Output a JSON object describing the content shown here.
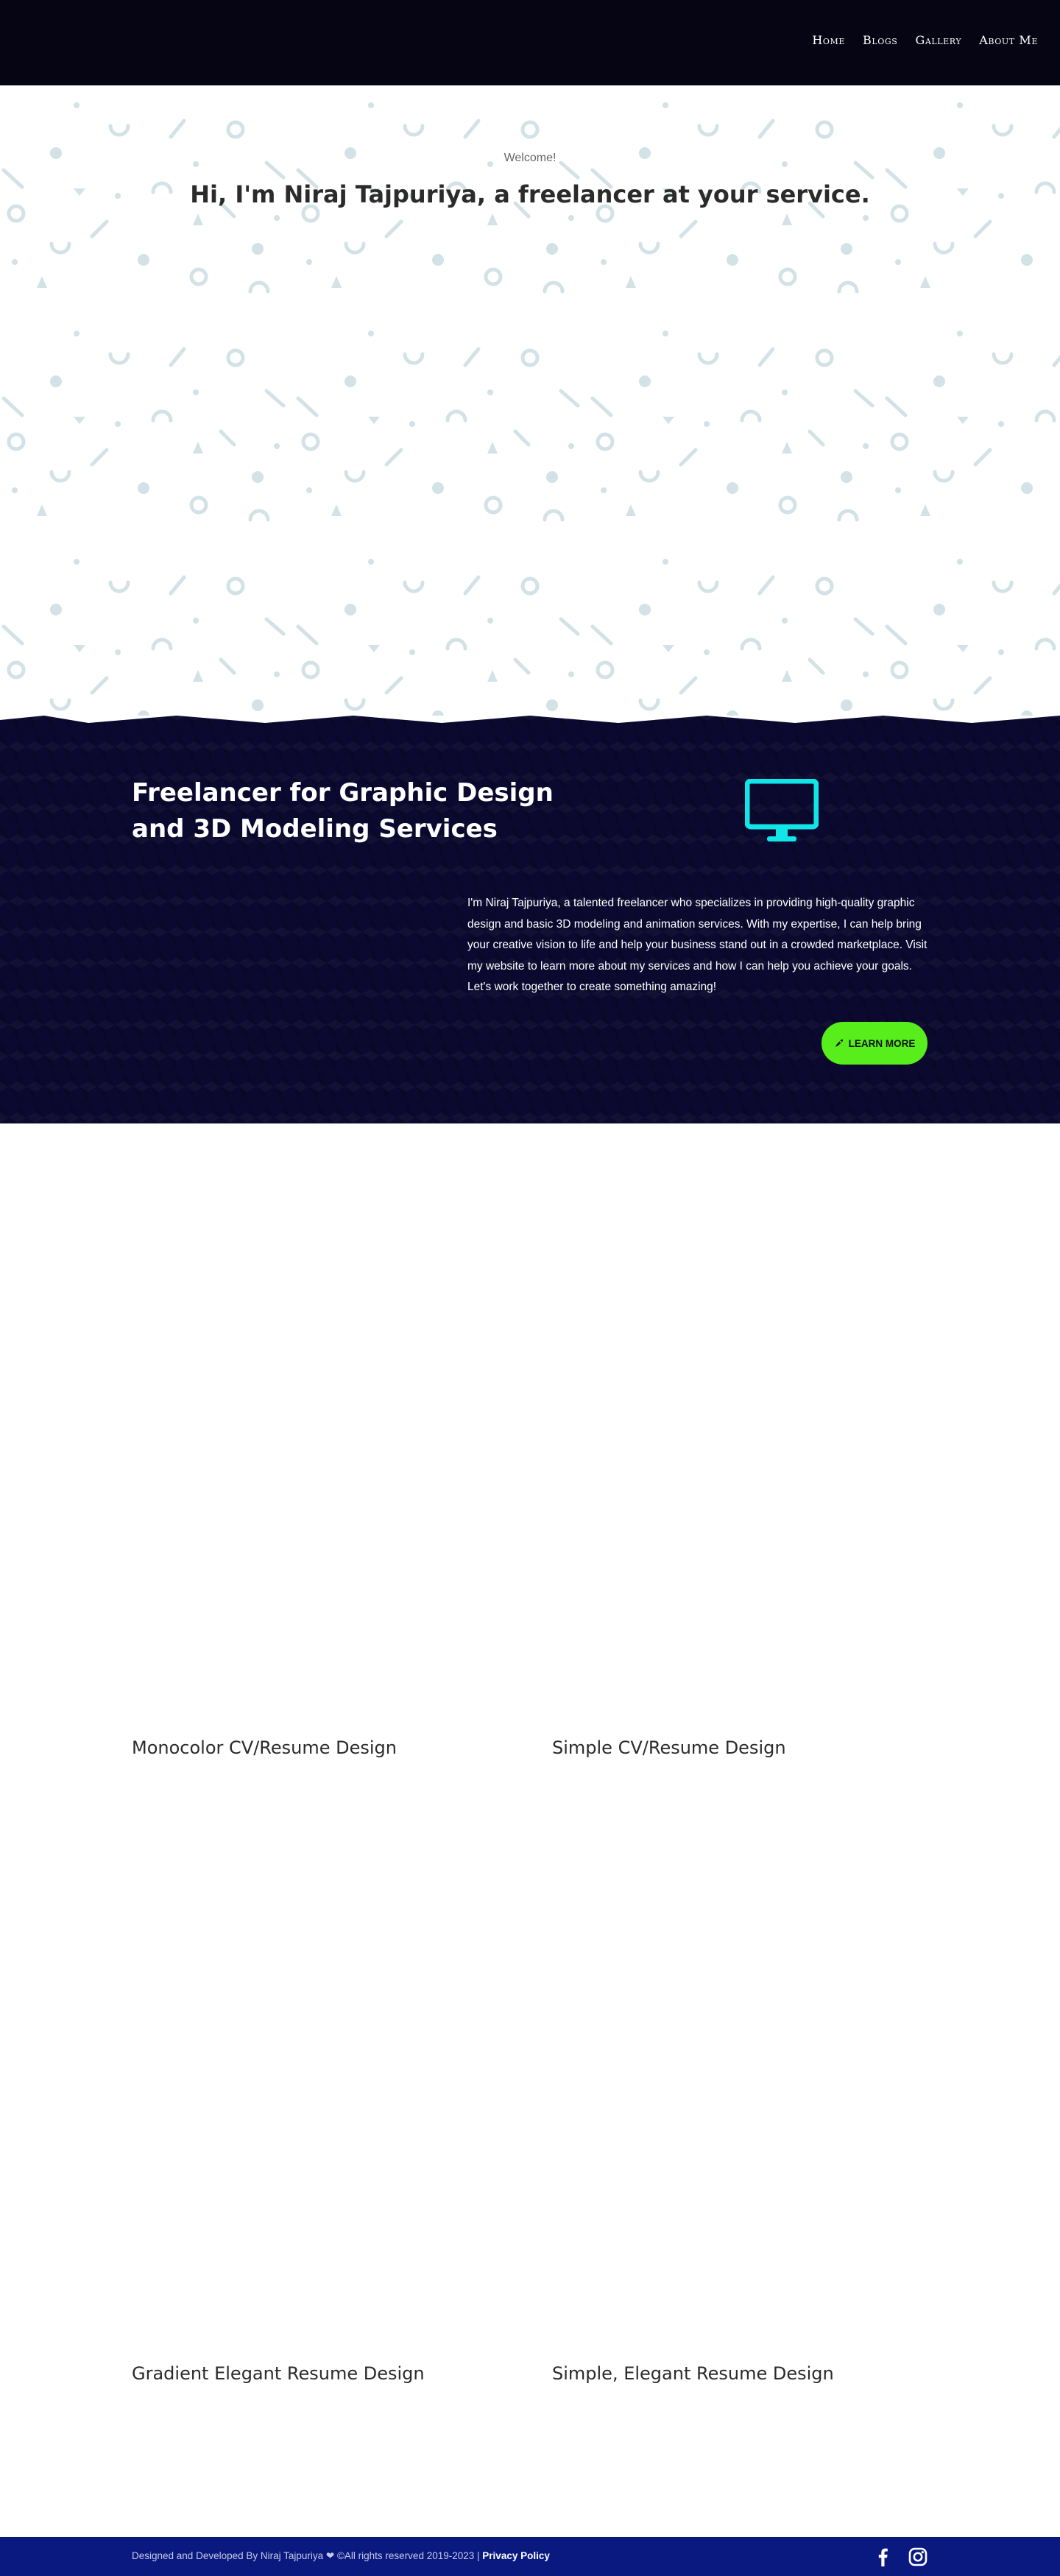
{
  "nav": {
    "items": [
      "Home",
      "Blogs",
      "Gallery",
      "About Me"
    ]
  },
  "hero": {
    "welcome": "Welcome!",
    "title": "Hi, I'm Niraj Tajpuriya, a freelancer at your service."
  },
  "services": {
    "title": "Freelancer for Graphic Design and 3D Modeling Services",
    "icon": "monitor-icon",
    "description": "I'm Niraj Tajpuriya, a talented freelancer who specializes in providing high-quality graphic design and basic 3D modeling and animation services. With my expertise, I can help bring your creative vision to life and help your business stand out in a crowded marketplace. Visit my website to learn more about my services and how I can help you achieve your goals. Let's work together to create something amazing!",
    "button_label": "LEARN MORE",
    "button_icon": "rocket-icon"
  },
  "resumes": [
    "Monocolor CV/Resume Design",
    "Simple CV/Resume Design",
    "Gradient Elegant Resume Design",
    "Simple, Elegant Resume Design"
  ],
  "footer": {
    "text": "Designed and Developed By Niraj Tajpuriya ❤ ©All rights reserved 2019-2023 |",
    "link": "Privacy Policy",
    "social": [
      "facebook-icon",
      "instagram-icon"
    ]
  },
  "colors": {
    "nav_bg": "#060514",
    "dark_bg": "#0b0930",
    "accent_cyan": "#11e5e8",
    "button_green": "#57ee1c",
    "footer_bg": "#0a1980",
    "pattern": "#d3e2e6"
  }
}
